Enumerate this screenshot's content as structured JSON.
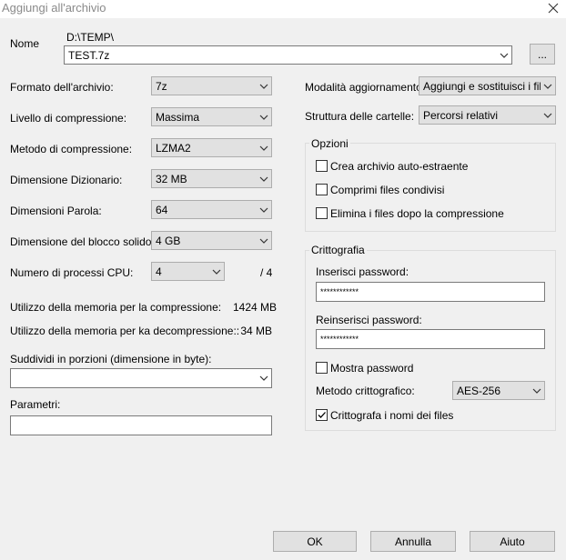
{
  "window": {
    "title": "Aggiungi all'archivio"
  },
  "archive": {
    "name_label": "Nome",
    "path": "D:\\TEMP\\",
    "filename": "TEST.7z",
    "browse_label": "..."
  },
  "left": {
    "format_label": "Formato dell'archivio:",
    "format_value": "7z",
    "level_label": "Livello di compressione:",
    "level_value": "Massima",
    "method_label": "Metodo di compressione:",
    "method_value": "LZMA2",
    "dict_label": "Dimensione Dizionario:",
    "dict_value": "32 MB",
    "word_label": "Dimensioni Parola:",
    "word_value": "64",
    "solid_label": "Dimensione del blocco solido:",
    "solid_value": "4 GB",
    "cpu_label": "Numero di processi CPU:",
    "cpu_value": "4",
    "cpu_total": "/ 4",
    "mem_comp_label": "Utilizzo della memoria per la compressione:",
    "mem_comp_value": "1424 MB",
    "mem_decomp_label": "Utilizzo della memoria per ka decompressione::",
    "mem_decomp_value": "34 MB",
    "split_label": "Suddividi in porzioni (dimensione in byte):",
    "split_value": "",
    "params_label": "Parametri:",
    "params_value": ""
  },
  "right": {
    "update_label": "Modalità aggiornamento:",
    "update_value": "Aggiungi e sostituisci i files",
    "paths_label": "Struttura delle cartelle:",
    "paths_value": "Percorsi relativi",
    "options": {
      "title": "Opzioni",
      "sfx_label": "Crea archivio auto-estraente",
      "sfx_checked": false,
      "shared_label": "Comprimi files condivisi",
      "shared_checked": false,
      "delete_label": "Elimina i files dopo la compressione",
      "delete_checked": false
    },
    "encryption": {
      "title": "Crittografia",
      "pwd_label": "Inserisci password:",
      "pwd_value": "************",
      "pwd2_label": "Reinserisci password:",
      "pwd2_value": "************",
      "show_label": "Mostra password",
      "show_checked": false,
      "method_label": "Metodo crittografico:",
      "method_value": "AES-256",
      "names_label": "Crittografa i nomi dei files",
      "names_checked": true
    }
  },
  "buttons": {
    "ok": "OK",
    "cancel": "Annulla",
    "help": "Aiuto"
  }
}
